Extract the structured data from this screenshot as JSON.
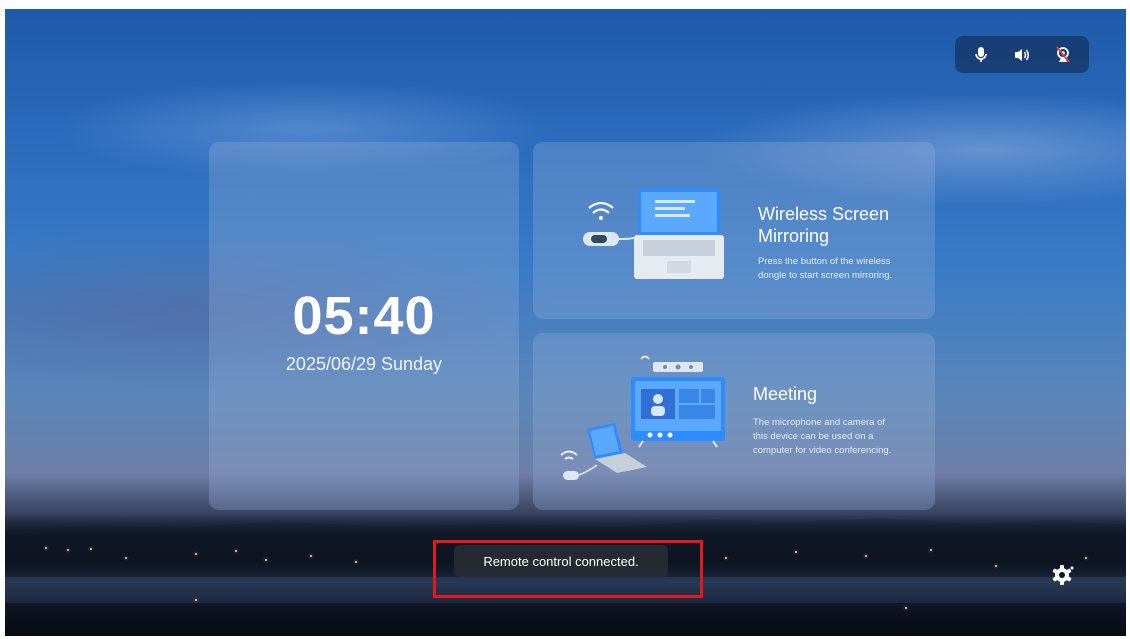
{
  "status_bar": {
    "icons": [
      "microphone-icon",
      "speaker-icon",
      "camera-off-icon"
    ]
  },
  "clock": {
    "time": "05:40",
    "date": "2025/06/29 Sunday"
  },
  "wireless_card": {
    "title_line1": "Wireless Screen",
    "title_line2": "Mirroring",
    "desc_line1": "Press the button of the wireless",
    "desc_line2": "dongle to start screen mirroring."
  },
  "meeting_card": {
    "title": "Meeting",
    "desc_line1": "The microphone and camera of",
    "desc_line2": "this device can be used on a",
    "desc_line3": "computer for video conferencing."
  },
  "toast": {
    "message": "Remote control connected."
  },
  "colors": {
    "highlight_border": "#e11b1b",
    "card_bg": "rgba(150,175,215,0.32)",
    "accent_blue": "#2f8cff"
  }
}
